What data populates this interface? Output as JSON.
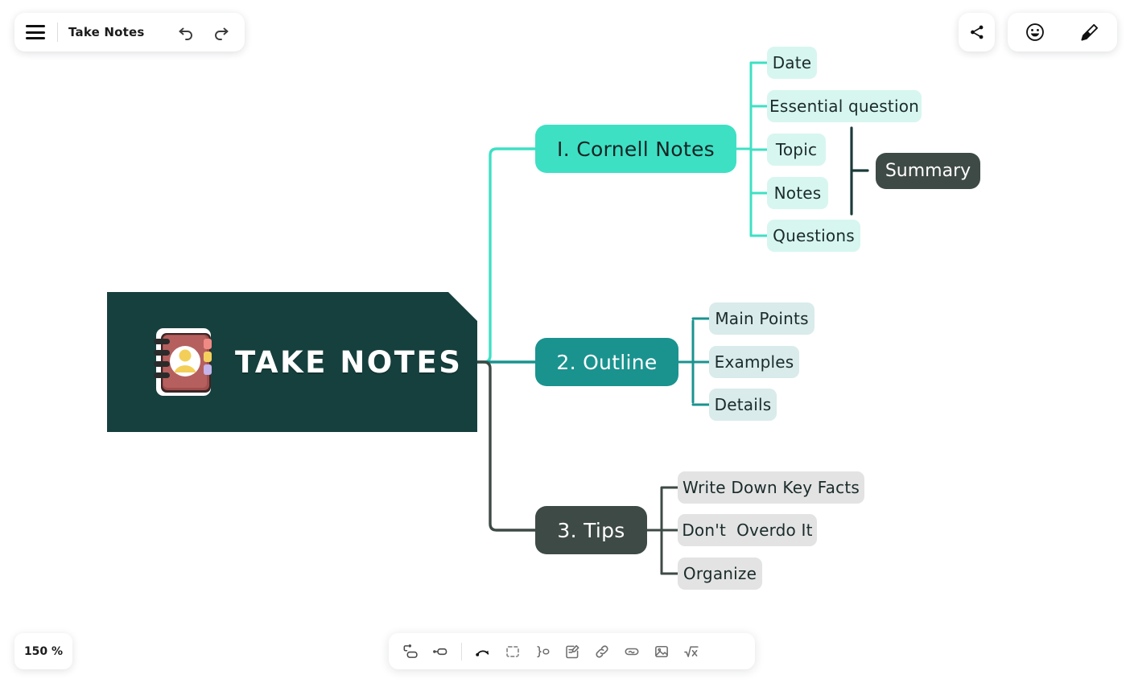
{
  "app": {
    "doc_title": "Take Notes",
    "zoom_level": "150 %"
  },
  "toolbar_left": {
    "menu_icon": "hamburger-menu-icon",
    "undo_icon": "undo-arrow-icon",
    "redo_icon": "redo-arrow-icon"
  },
  "toolbar_right": {
    "share_icon": "share-icon",
    "emoji_icon": "smiley-face-icon",
    "brush_icon": "highlighter-brush-icon"
  },
  "toolbar_bottom": {
    "items": [
      {
        "name": "add-subtopic-icon",
        "label": "Subtopic"
      },
      {
        "name": "add-sibling-topic-icon",
        "label": "Topic"
      },
      {
        "name": "relationship-arrow-icon",
        "label": "Relationship"
      },
      {
        "name": "boundary-icon",
        "label": "Boundary"
      },
      {
        "name": "summary-bracket-icon",
        "label": "Summary"
      },
      {
        "name": "note-icon",
        "label": "Note"
      },
      {
        "name": "hyperlink-icon",
        "label": "Link"
      },
      {
        "name": "sticker-icon",
        "label": "Sticker"
      },
      {
        "name": "image-icon",
        "label": "Image"
      },
      {
        "name": "formula-icon",
        "label": "Formula"
      }
    ]
  },
  "mindmap": {
    "root": {
      "title": "TAKE NOTES",
      "icon": "notebook-contacts-icon",
      "color": "#16403d"
    },
    "branches": [
      {
        "id": "cornell",
        "label": "I. Cornell Notes",
        "color": "#3ee0c4",
        "children": [
          {
            "label": "Date"
          },
          {
            "label": "Essential question"
          },
          {
            "label": "Topic"
          },
          {
            "label": "Notes"
          },
          {
            "label": "Questions"
          }
        ],
        "summary": {
          "label": "Summary",
          "color": "#3e4a45",
          "covers": [
            "Topic",
            "Notes"
          ]
        }
      },
      {
        "id": "outline",
        "label": "2. Outline",
        "color": "#1a938f",
        "children": [
          {
            "label": "Main Points"
          },
          {
            "label": "Examples"
          },
          {
            "label": "Details"
          }
        ]
      },
      {
        "id": "tips",
        "label": "3. Tips",
        "color": "#3e4a45",
        "children": [
          {
            "label": "Write Down Key Facts"
          },
          {
            "label": "Don't  Overdo It"
          },
          {
            "label": "Organize"
          }
        ]
      }
    ]
  }
}
